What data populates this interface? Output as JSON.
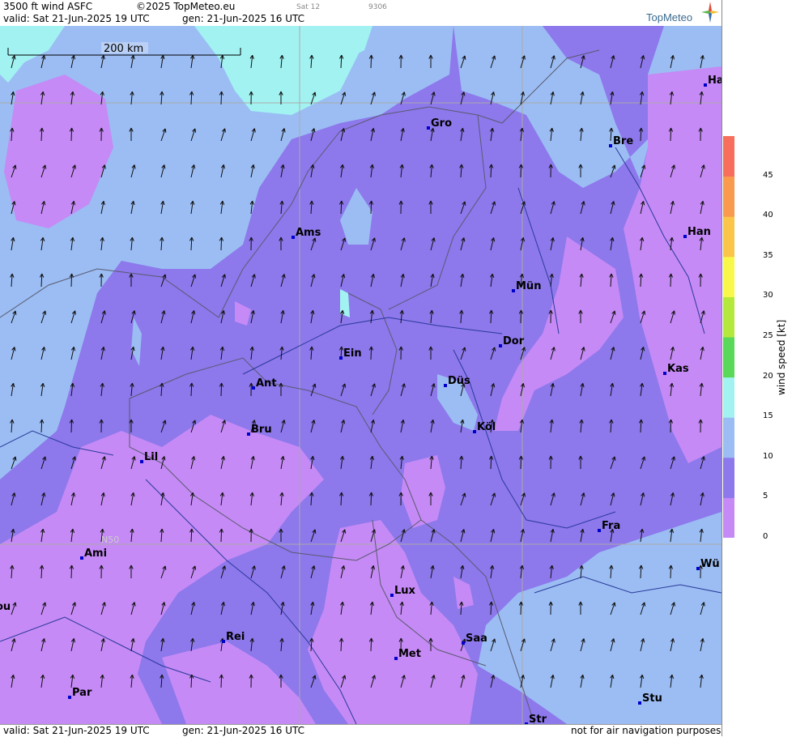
{
  "header": {
    "product": "3500 ft wind ASFC",
    "copyright": "©2025 TopMeteo.eu",
    "run_label": "Sat 12",
    "code": "9306",
    "valid": "valid:  Sat  21-Jun-2025  19 UTC",
    "generated": "gen: 21-Jun-2025 16 UTC"
  },
  "footer": {
    "valid": "valid:  Sat  21-Jun-2025  19 UTC",
    "generated": "gen: 21-Jun-2025 16 UTC",
    "disclaimer": "not for air navigation purposes"
  },
  "logo": {
    "text": "TopMeteo"
  },
  "scale_bar": {
    "label": "200 km"
  },
  "graticule": {
    "lat_label": "N50"
  },
  "legend": {
    "title": "wind speed [kt]",
    "ticks": [
      "0",
      "5",
      "10",
      "15",
      "20",
      "25",
      "30",
      "35",
      "40",
      "45"
    ],
    "colors": [
      "#c58af5",
      "#8d78ec",
      "#9bbdf3",
      "#a2f2f2",
      "#5ad85a",
      "#b5e83c",
      "#f8f84a",
      "#fbc54a",
      "#f99a4f",
      "#f76f5c"
    ]
  },
  "cities": [
    {
      "name": "Gro"
    },
    {
      "name": "Bre"
    },
    {
      "name": "Ha"
    },
    {
      "name": "Ams"
    },
    {
      "name": "Han"
    },
    {
      "name": "Mün"
    },
    {
      "name": "Dor"
    },
    {
      "name": "Ein"
    },
    {
      "name": "Kas"
    },
    {
      "name": "Ant"
    },
    {
      "name": "Düs"
    },
    {
      "name": "Bru"
    },
    {
      "name": "Köl"
    },
    {
      "name": "Lil"
    },
    {
      "name": "Fra"
    },
    {
      "name": "Ami"
    },
    {
      "name": "Wü"
    },
    {
      "name": "Lux"
    },
    {
      "name": "ou"
    },
    {
      "name": "Rei"
    },
    {
      "name": "Saa"
    },
    {
      "name": "Met"
    },
    {
      "name": "Par"
    },
    {
      "name": "Stu"
    },
    {
      "name": "Str"
    }
  ],
  "wind_direction": "from south-southwest"
}
